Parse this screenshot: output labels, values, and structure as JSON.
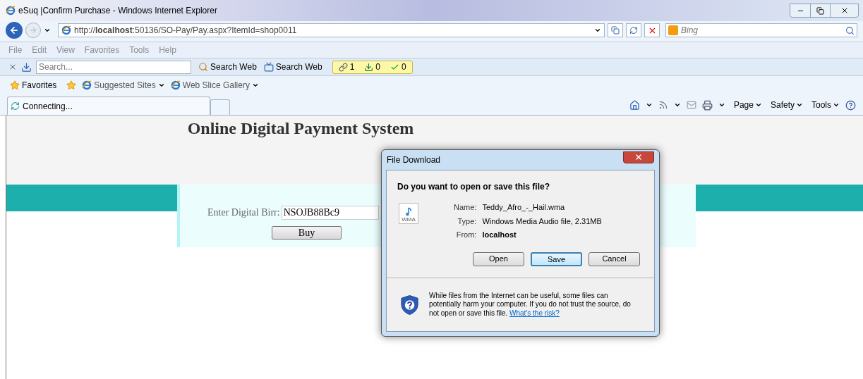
{
  "window": {
    "title": "eSuq |Confirm Purchase - Windows Internet Explorer"
  },
  "address": {
    "url": "http://**localhost**:50136/SO-Pay/Pay.aspx?ItemId=shop0011"
  },
  "search_box": {
    "placeholder": "Bing"
  },
  "menu": [
    "File",
    "Edit",
    "View",
    "Favorites",
    "Tools",
    "Help"
  ],
  "toolbar": {
    "search_placeholder": "Search...",
    "buttons": [
      "Search Web",
      "Search Web"
    ],
    "counters": [
      {
        "kind": "links",
        "text": "1"
      },
      {
        "kind": "downloads",
        "text": "0"
      },
      {
        "kind": "checks",
        "text": "0"
      }
    ]
  },
  "favorites_bar": {
    "label": "Favorites",
    "links": [
      "Suggested Sites",
      "Web Slice Gallery"
    ]
  },
  "tab": {
    "label": "Connecting..."
  },
  "command_bar": [
    "Page",
    "Safety",
    "Tools"
  ],
  "page": {
    "heading": "Online Digital Payment System",
    "field_label": "Enter Digital Birr:",
    "field_value": "NSOJB88Bc9",
    "button": "Buy"
  },
  "dialog": {
    "title": "File Download",
    "question": "Do you want to open or save this file?",
    "details": [
      {
        "label": "Name:",
        "value": "Teddy_Afro_-_Hail.wma",
        "bold": false
      },
      {
        "label": "Type:",
        "value": "Windows Media Audio file, 2.31MB",
        "bold": false
      },
      {
        "label": "From:",
        "value": "localhost",
        "bold": true
      }
    ],
    "file_badge": "WMA",
    "buttons": [
      {
        "label": "Open",
        "focused": false
      },
      {
        "label": "Save",
        "focused": true
      },
      {
        "label": "Cancel",
        "focused": false
      }
    ],
    "warning": "While files from the Internet can be useful, some files can potentially harm your computer. If you do not trust the source, do not open or save this file.",
    "link": "What's the risk?"
  }
}
